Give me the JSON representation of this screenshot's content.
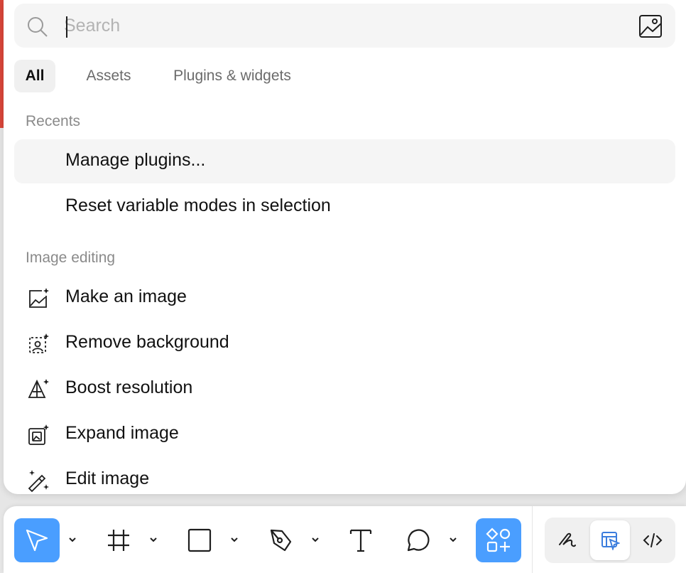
{
  "search": {
    "placeholder": "Search"
  },
  "tabs": [
    {
      "label": "All",
      "active": true
    },
    {
      "label": "Assets",
      "active": false
    },
    {
      "label": "Plugins & widgets",
      "active": false
    }
  ],
  "recents": {
    "header": "Recents",
    "items": [
      {
        "label": "Manage plugins..."
      },
      {
        "label": "Reset variable modes in selection"
      }
    ]
  },
  "image_editing": {
    "header": "Image editing",
    "items": [
      {
        "label": "Make an image",
        "icon": "image-sparkle-icon"
      },
      {
        "label": "Remove background",
        "icon": "remove-background-icon"
      },
      {
        "label": "Boost resolution",
        "icon": "boost-resolution-icon"
      },
      {
        "label": "Expand image",
        "icon": "expand-image-icon"
      },
      {
        "label": "Edit image",
        "icon": "magic-wand-icon"
      }
    ]
  },
  "toolbar": {
    "tools": [
      "move-tool",
      "frame-tool",
      "rectangle-tool",
      "pen-tool",
      "text-tool",
      "comment-tool",
      "actions-tool"
    ],
    "modes": [
      "draw-mode",
      "design-mode",
      "dev-mode"
    ],
    "accent_color": "#4a9eff"
  }
}
